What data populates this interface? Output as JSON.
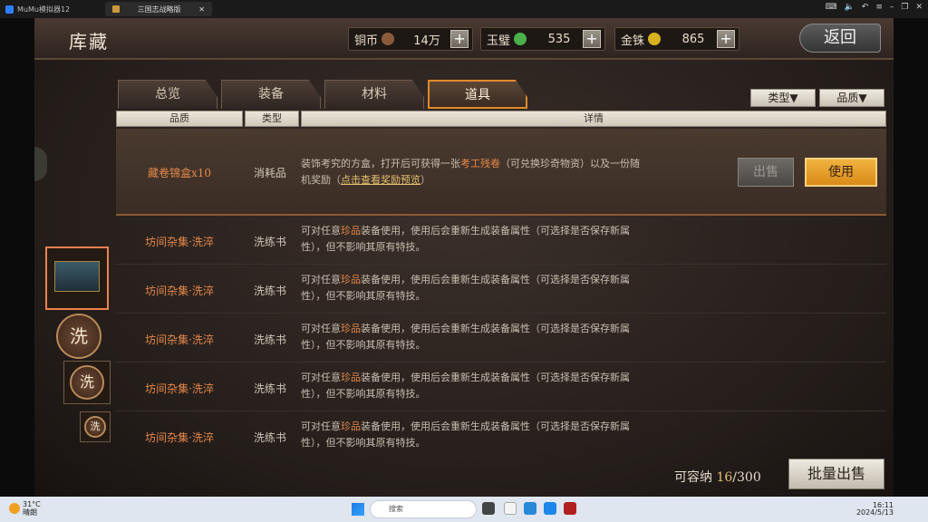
{
  "window": {
    "app_name": "MuMu模拟器12",
    "tab_title": "三国志战略版"
  },
  "header": {
    "page_title": "库藏",
    "back_label": "返回",
    "resources": [
      {
        "name": "铜币",
        "value": "14万",
        "coin_color": "#8a5a3a"
      },
      {
        "name": "玉璧",
        "value": "535",
        "coin_color": "#4bb04a"
      },
      {
        "name": "金铢",
        "value": "865",
        "coin_color": "#d8b020"
      }
    ]
  },
  "tabs": [
    {
      "label": "总览"
    },
    {
      "label": "装备"
    },
    {
      "label": "材料"
    },
    {
      "label": "道具",
      "active": true
    }
  ],
  "filters": {
    "type_label": "类型▼",
    "quality_label": "品质▼"
  },
  "columns": {
    "quality": "品质",
    "type": "类型",
    "detail": "详情"
  },
  "selected": {
    "name": "藏卷锦盒x10",
    "type": "消耗品",
    "desc_1": "装饰考究的方盒，打开后可获得一张",
    "desc_hl": "考工残卷",
    "desc_2": "（可兑换珍奇物资）以及一份随机奖励（",
    "desc_link": "点击查看奖励预览",
    "desc_3": "）",
    "sell_label": "出售",
    "use_label": "使用"
  },
  "items": [
    {
      "name": "坊间杂集·洗淬",
      "type": "洗练书",
      "d1": "可对任意",
      "hl": "珍品",
      "d2": "装备使用，使用后会重新生成装备属性（可",
      "d3": "选择是否保存新属性），但不影响其原有特技。"
    },
    {
      "name": "坊间杂集·洗淬",
      "type": "洗练书",
      "d1": "可对任意",
      "hl": "珍品",
      "d2": "装备使用，使用后会重新生成装备属性（可",
      "d3": "选择是否保存新属性），但不影响其原有特技。"
    },
    {
      "name": "坊间杂集·洗淬",
      "type": "洗练书",
      "d1": "可对任意",
      "hl": "珍品",
      "d2": "装备使用，使用后会重新生成装备属性（可",
      "d3": "选择是否保存新属性），但不影响其原有特技。"
    },
    {
      "name": "坊间杂集·洗淬",
      "type": "洗练书",
      "d1": "可对任意",
      "hl": "珍品",
      "d2": "装备使用，使用后会重新生成装备属性（可",
      "d3": "选择是否保存新属性），但不影响其原有特技。"
    },
    {
      "name": "坊间杂集·洗淬",
      "type": "洗练书",
      "d1": "可对任意",
      "hl": "珍品",
      "d2": "装备使用，使用后会重新生成装备属性（可",
      "d3": "选择是否保存新属性），但不影响其原有特技。"
    }
  ],
  "thumb_glyph": "洗",
  "capacity": {
    "label": "可容纳 ",
    "current": "16",
    "max": "/300"
  },
  "batch_sell_label": "批量出售",
  "taskbar": {
    "temp": "31°C",
    "weather": "晴朗",
    "search_placeholder": "搜索",
    "time": "16:11",
    "date": "2024/5/13"
  }
}
